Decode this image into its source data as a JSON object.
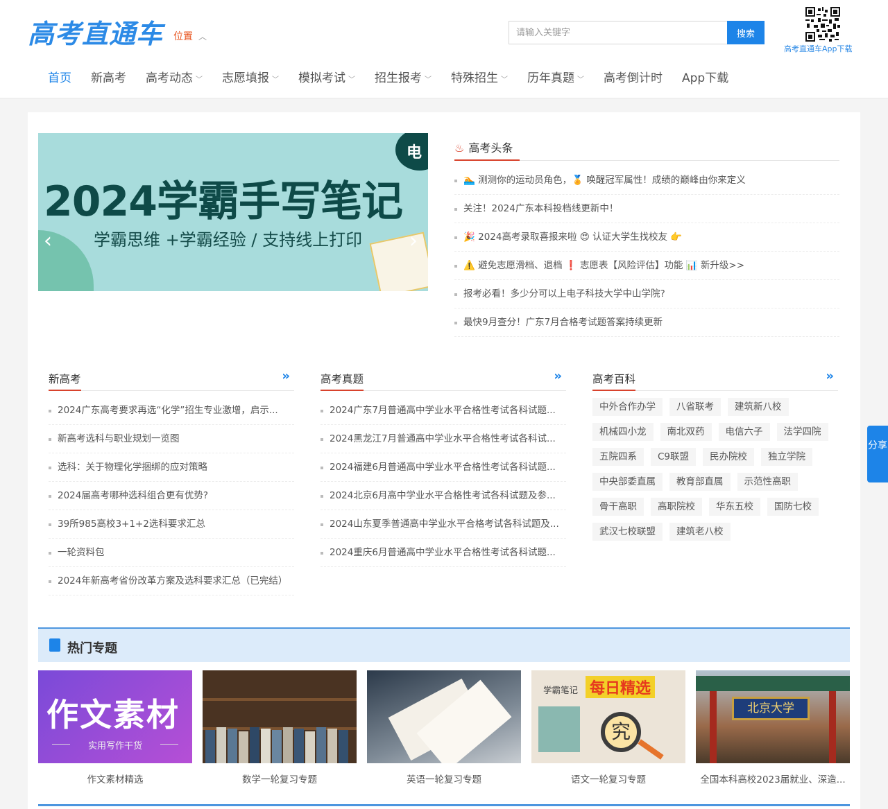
{
  "header": {
    "logo": "高考直通车",
    "location": "位置",
    "search_placeholder": "请输入关键字",
    "search_button": "搜索",
    "app_download": "高考直通车App下载"
  },
  "nav": {
    "items": [
      {
        "label": "首页"
      },
      {
        "label": "新高考"
      },
      {
        "label": "高考动态"
      },
      {
        "label": "志愿填报"
      },
      {
        "label": "模拟考试"
      },
      {
        "label": "招生报考"
      },
      {
        "label": "特殊招生"
      },
      {
        "label": "历年真题"
      },
      {
        "label": "高考倒计时"
      },
      {
        "label": "App下载"
      }
    ]
  },
  "banner": {
    "title": "2024学霸手写笔记",
    "subtitle": "学霸思维 +学霸经验 / 支持线上打印",
    "badge": "电"
  },
  "headlines": {
    "title": "高考头条",
    "items": [
      "🏊 测测你的运动员角色，🏅 唤醒冠军属性！成绩的巅峰由你来定义",
      "关注！2024广东本科投档线更新中！",
      "🎉 2024高考录取喜报来啦 😍 认证大学生找校友 👉",
      "⚠️ 避免志愿滑档、退档 ❗ 志愿表【风险评估】功能 📊 新升级>>",
      "报考必看！多少分可以上电子科技大学中山学院?",
      "最快9月查分！广东7月合格考试题答案持续更新"
    ]
  },
  "col_new": {
    "title": "新高考",
    "items": [
      "2024广东高考要求再选“化学”招生专业激增，启示...",
      "新高考选科与职业规划一览图",
      "选科：关于物理化学捆绑的应对策略",
      "2024届高考哪种选科组合更有优势?",
      "39所985高校3+1+2选科要求汇总",
      "一轮资料包",
      "2024年新高考省份改革方案及选科要求汇总（已完结）"
    ]
  },
  "col_exam": {
    "title": "高考真题",
    "items": [
      "2024广东7月普通高中学业水平合格性考试各科试题...",
      "2024黑龙江7月普通高中学业水平合格性考试各科试...",
      "2024福建6月普通高中学业水平合格性考试各科试题...",
      "2024北京6月高中学业水平合格性考试各科试题及参...",
      "2024山东夏季普通高中学业水平合格考试各科试题及...",
      "2024重庆6月普通高中学业水平合格性考试各科试题..."
    ]
  },
  "col_wiki": {
    "title": "高考百科",
    "tags": [
      "中外合作办学",
      "八省联考",
      "建筑新八校",
      "机械四小龙",
      "南北双药",
      "电信六子",
      "法学四院",
      "五院四系",
      "C9联盟",
      "民办院校",
      "独立学院",
      "中央部委直属",
      "教育部直属",
      "示范性高职",
      "骨干高职",
      "高职院校",
      "华东五校",
      "国防七校",
      "武汉七校联盟",
      "建筑老八校"
    ]
  },
  "hot": {
    "title": "热门专题",
    "cards": [
      {
        "caption": "作文素材精选",
        "img_big": "作文素材",
        "img_small": "实用写作干货"
      },
      {
        "caption": "数学一轮复习专题"
      },
      {
        "caption": "英语一轮复习专题"
      },
      {
        "caption": "语文一轮复习专题",
        "img_small": "学霸笔记",
        "img_big": "每日精选",
        "img_char": "究"
      },
      {
        "caption": "全国本科高校2023届就业、深造...",
        "img_plaque": "北京大学"
      }
    ]
  },
  "share": "分享",
  "colors": {
    "brand": "#1d84e8",
    "accent": "#d8422c"
  }
}
